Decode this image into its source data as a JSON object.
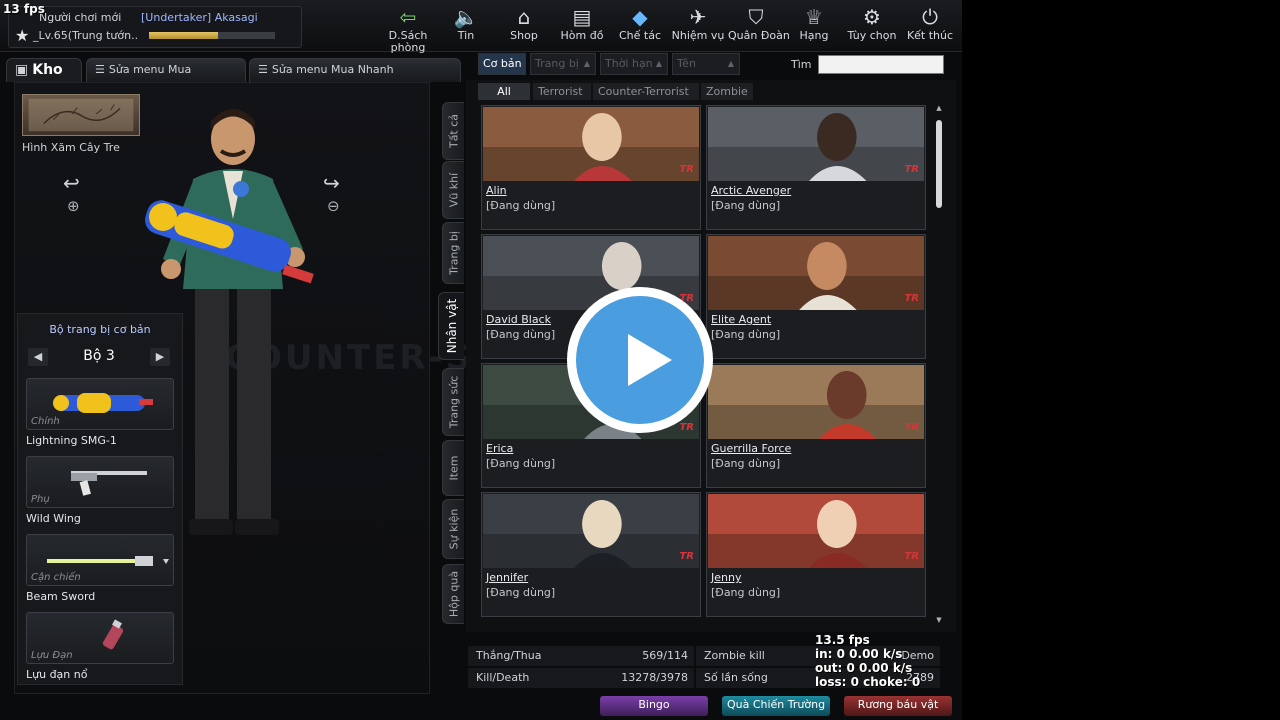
{
  "fps_top": "13 fps",
  "player": {
    "name": "Người chơi mới",
    "clan": "[Undertaker] Akasagi",
    "level": "_Lv.65(Trung tướn..",
    "xp_fraction": 0.55
  },
  "top_menu": [
    {
      "label": "D.Sách phòng",
      "icon": "back-arrow-icon"
    },
    {
      "label": "Tin",
      "icon": "speaker-icon"
    },
    {
      "label": "Shop",
      "icon": "shop-icon"
    },
    {
      "label": "Hòm đồ",
      "icon": "suitcase-icon"
    },
    {
      "label": "Chế tác",
      "icon": "controller-icon"
    },
    {
      "label": "Nhiệm vụ",
      "icon": "mission-icon"
    },
    {
      "label": "Quân Đoàn",
      "icon": "clan-shield-icon"
    },
    {
      "label": "Hạng",
      "icon": "trophy-icon"
    },
    {
      "label": "Tùy chọn",
      "icon": "gear-icon"
    },
    {
      "label": "Kết thúc",
      "icon": "power-icon"
    }
  ],
  "tabs": [
    {
      "label": "Kho",
      "icon": "inventory-icon"
    },
    {
      "label": "Sửa menu Mua",
      "icon": "list-icon"
    },
    {
      "label": "Sửa menu Mua Nhanh",
      "icon": "list-icon"
    }
  ],
  "tattoo": {
    "name": "Hình Xăm Cây Tre"
  },
  "loadout": {
    "title": "Bộ trang bị cơ bản",
    "set_name": "Bộ 3",
    "slots": [
      {
        "category": "Chính",
        "name": "Lightning SMG-1"
      },
      {
        "category": "Phụ",
        "name": "Wild Wing"
      },
      {
        "category": "Cận chiến",
        "name": "Beam Sword"
      },
      {
        "category": "Lựu Đạn",
        "name": "Lựu đạn nổ"
      }
    ]
  },
  "vertical_tabs": [
    "Tất cả",
    "Vũ khí",
    "Trang bị",
    "Nhân vật",
    "Trang sức",
    "Item",
    "Sự kiện",
    "Hộp quà"
  ],
  "filters": [
    {
      "label": "Cơ bản"
    },
    {
      "label": "Trang bị"
    },
    {
      "label": "Thời hạn"
    },
    {
      "label": "Tên"
    }
  ],
  "search": {
    "label": "Tìm",
    "value": ""
  },
  "teams": [
    "All",
    "Terrorist",
    "Counter-Terrorist",
    "Zombie"
  ],
  "characters": [
    {
      "name": "Alin",
      "status": "[Đang dùng]",
      "badge": "TR"
    },
    {
      "name": "Arctic Avenger",
      "status": "[Đang dùng]",
      "badge": "TR"
    },
    {
      "name": "David Black",
      "status": "[Đang dùng]",
      "badge": "TR"
    },
    {
      "name": "Elite Agent",
      "status": "[Đang dùng]",
      "badge": "TR"
    },
    {
      "name": "Erica",
      "status": "[Đang dùng]",
      "badge": "TR"
    },
    {
      "name": "Guerrilla Force",
      "status": "[Đang dùng]",
      "badge": "TR"
    },
    {
      "name": "Jennifer",
      "status": "[Đang dùng]",
      "badge": "TR"
    },
    {
      "name": "Jenny",
      "status": "[Đang dùng]",
      "badge": "TR"
    }
  ],
  "stats": {
    "win_loss_label": "Thắng/Thua",
    "win_loss": "569/114",
    "kill_death_label": "Kill/Death",
    "kill_death": "13278/3978",
    "zombie_kill_label": "Zombie kill",
    "zombie_kill": "Demo",
    "lives_label": "Số lần sống",
    "lives": "2789"
  },
  "bottom_buttons": [
    {
      "label": "Bingo"
    },
    {
      "label": "Quà Chiến Trường"
    },
    {
      "label": "Rương báu vật"
    }
  ],
  "net": {
    "fps": "13.5 fps",
    "in": "in:  0 0.00 k/s",
    "out": "out:  0 0.00 k/s",
    "loss": "loss: 0 choke: 0"
  },
  "watermark": "COUNTER-STRIKE",
  "colors": {
    "accent_blue": "#24364c",
    "badge_red": "#d8333a",
    "play_blue": "#4a9ee0",
    "bingo": "#7a3fa8",
    "battle_gift": "#1e8ba0",
    "treasure": "#9a3232"
  }
}
